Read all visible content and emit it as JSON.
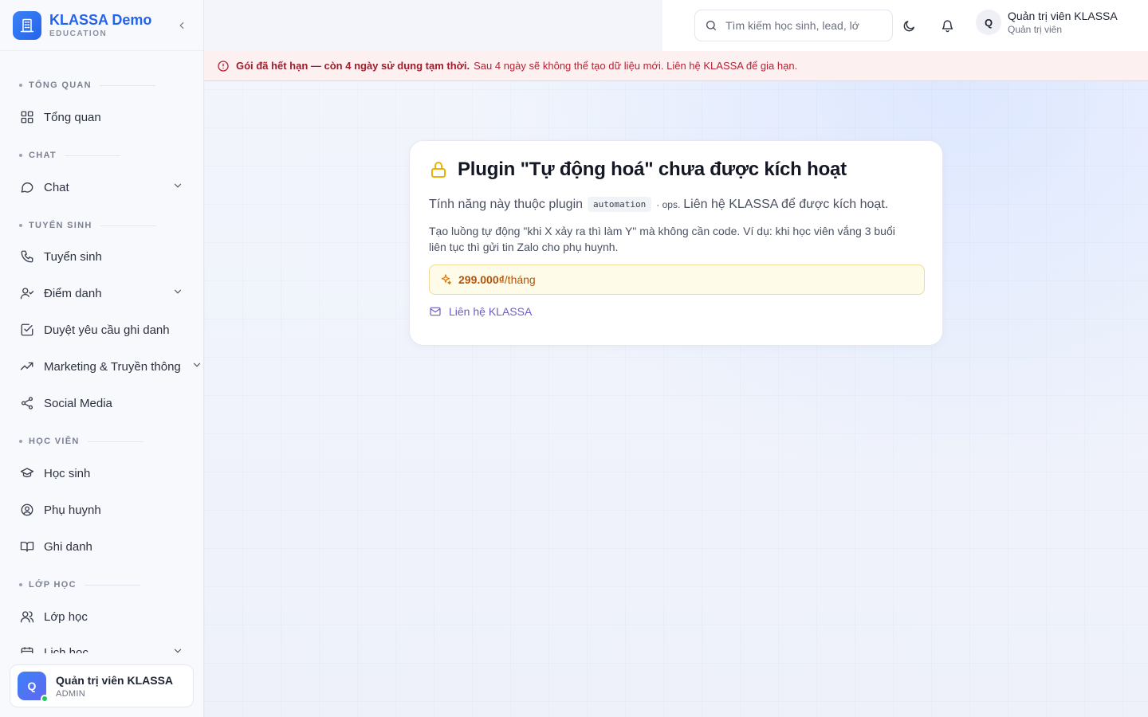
{
  "brand": {
    "name": "KLASSA Demo",
    "subtitle": "EDUCATION"
  },
  "sidebar": {
    "sections": [
      {
        "label": "TỔNG QUAN"
      },
      {
        "label": "CHAT"
      },
      {
        "label": "TUYỂN SINH"
      },
      {
        "label": "HỌC VIÊN"
      },
      {
        "label": "LỚP HỌC"
      }
    ],
    "items": [
      {
        "label": "Tổng quan",
        "icon": "dashboard-grid-icon"
      },
      {
        "label": "Chat",
        "icon": "chat-bubble-icon",
        "expandable": true
      },
      {
        "label": "Tuyển sinh",
        "icon": "phone-icon"
      },
      {
        "label": "Điểm danh",
        "icon": "user-check-icon",
        "expandable": true
      },
      {
        "label": "Duyệt yêu cầu ghi danh",
        "icon": "checkbox-icon"
      },
      {
        "label": "Marketing & Truyền thông",
        "icon": "trending-up-icon",
        "expandable": true
      },
      {
        "label": "Social Media",
        "icon": "share-icon"
      },
      {
        "label": "Học sinh",
        "icon": "graduation-cap-icon"
      },
      {
        "label": "Phụ huynh",
        "icon": "user-circle-icon"
      },
      {
        "label": "Ghi danh",
        "icon": "book-open-icon"
      },
      {
        "label": "Lớp học",
        "icon": "users-icon"
      },
      {
        "label": "Lịch học",
        "icon": "calendar-icon",
        "expandable": true
      }
    ],
    "user": {
      "initial": "Q",
      "name": "Quản trị viên KLASSA",
      "role": "ADMIN"
    }
  },
  "topbar": {
    "search_placeholder": "Tìm kiếm học sinh, lead, lớ",
    "user": {
      "initial": "Q",
      "name": "Quản trị viên KLASSA",
      "role": "Quản trị viên"
    }
  },
  "alert": {
    "bold": "Gói đã hết hạn — còn 4 ngày sử dụng tạm thời.",
    "rest": "Sau 4 ngày sẽ không thể tạo dữ liệu mới. Liên hệ KLASSA để gia hạn."
  },
  "card": {
    "title": "Plugin \"Tự động hoá\" chưa được kích hoạt",
    "desc_prefix": "Tính năng này thuộc plugin",
    "plugin_code": "automation",
    "desc_ops": "· ops.",
    "desc_suffix": "Liên hệ KLASSA để được kích hoạt.",
    "body": "Tạo luồng tự động \"khi X xảy ra thì làm Y\" mà không cần code. Ví dụ: khi học viên vắng 3 buổi liên tục thì gửi tin Zalo cho phụ huynh.",
    "price_value": "299.000₫",
    "price_unit": "/tháng",
    "contact_label": "Liên hệ KLASSA"
  },
  "colors": {
    "brand": "#2563eb",
    "alert_text": "#9f1d2a",
    "alert_bg": "#fdf0f1",
    "lock_icon": "#eab308",
    "price_text": "#b45309",
    "contact_link": "#6d5fbf"
  }
}
